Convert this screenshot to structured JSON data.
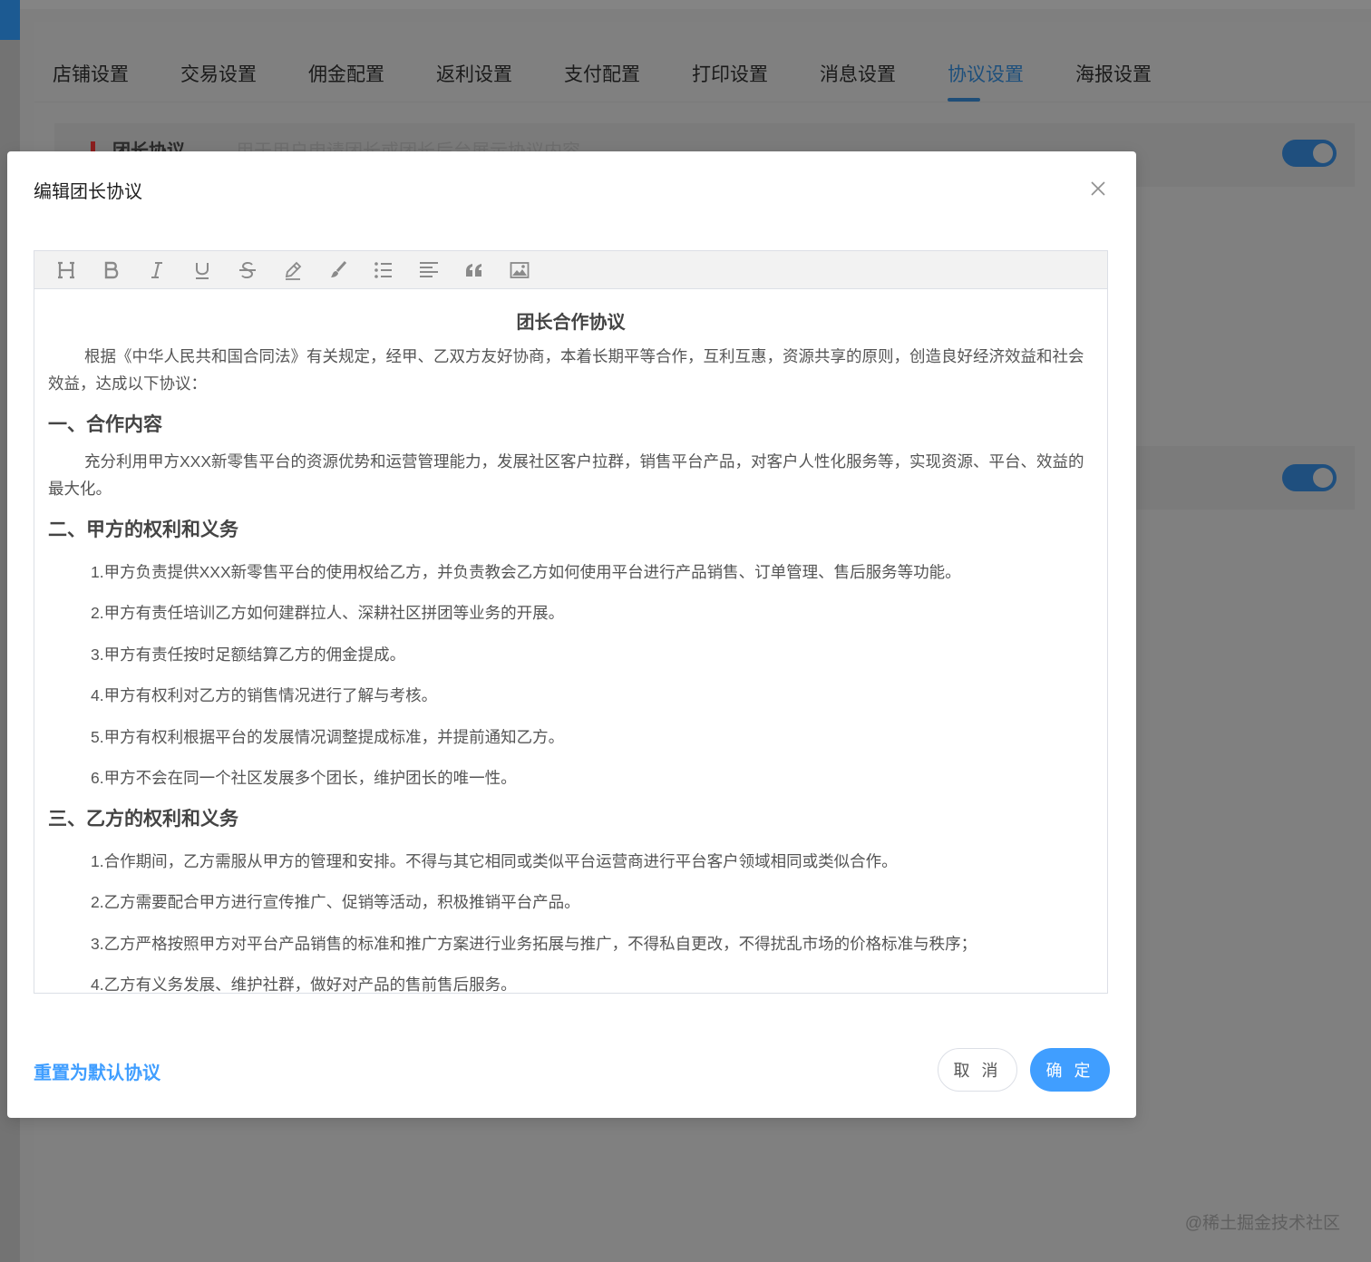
{
  "background": {
    "tabs": [
      "店铺设置",
      "交易设置",
      "佣金配置",
      "返利设置",
      "支付配置",
      "打印设置",
      "消息设置",
      "协议设置",
      "海报设置"
    ],
    "active_tab": "协议设置",
    "row1_title": "团长协议",
    "row1_desc": "用于用户申请团长或团长后台展示协议内容",
    "watermark": "@稀土掘金技术社区"
  },
  "dialog": {
    "title": "编辑团长协议",
    "toolbar_icons": [
      "heading-icon",
      "bold-icon",
      "italic-icon",
      "underline-icon",
      "strikethrough-icon",
      "highlight-icon",
      "brush-icon",
      "list-icon",
      "align-icon",
      "quote-icon",
      "image-icon"
    ],
    "document": {
      "title": "团长合作协议",
      "intro": "根据《中华人民共和国合同法》有关规定，经甲、乙双方友好协商，本着长期平等合作，互利互惠，资源共享的原则，创造良好经济效益和社会效益，达成以下协议：",
      "section1": {
        "heading": "一、合作内容",
        "text": "充分利用甲方XXX新零售平台的资源优势和运营管理能力，发展社区客户拉群，销售平台产品，对客户人性化服务等，实现资源、平台、效益的最大化。"
      },
      "section2": {
        "heading": "二、甲方的权利和义务",
        "items": [
          "1.甲方负责提供XXX新零售平台的使用权给乙方，并负责教会乙方如何使用平台进行产品销售、订单管理、售后服务等功能。",
          "2.甲方有责任培训乙方如何建群拉人、深耕社区拼团等业务的开展。",
          "3.甲方有责任按时足额结算乙方的佣金提成。",
          "4.甲方有权利对乙方的销售情况进行了解与考核。",
          "5.甲方有权利根据平台的发展情况调整提成标准，并提前通知乙方。",
          "6.甲方不会在同一个社区发展多个团长，维护团长的唯一性。"
        ]
      },
      "section3": {
        "heading": "三、乙方的权利和义务",
        "items": [
          "1.合作期间，乙方需服从甲方的管理和安排。不得与其它相同或类似平台运营商进行平台客户领域相同或类似合作。",
          "2.乙方需要配合甲方进行宣传推广、促销等活动，积极推销平台产品。",
          "3.乙方严格按照甲方对平台产品销售的标准和推广方案进行业务拓展与推广，不得私自更改，不得扰乱市场的价格标准与秩序；",
          "4.乙方有义务发展、维护社群，做好对产品的售前售后服务。"
        ]
      }
    },
    "reset_label": "重置为默认协议",
    "cancel_label": "取 消",
    "ok_label": "确 定"
  },
  "colors": {
    "primary": "#409eff",
    "overlay": "#7f7f7f"
  }
}
